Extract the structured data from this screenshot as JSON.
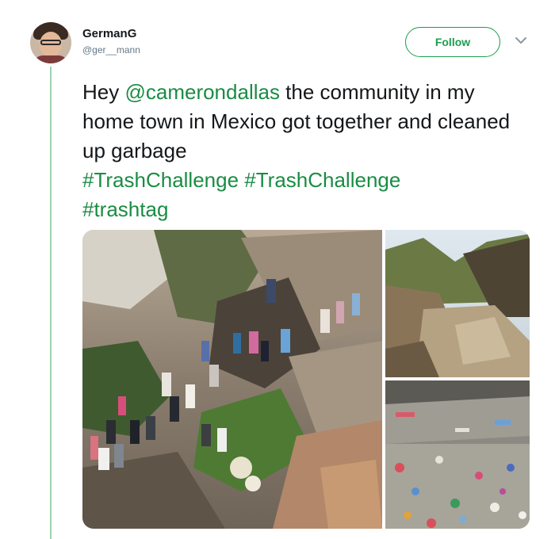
{
  "tweet": {
    "display_name": "GermanG",
    "handle": "@ger__mann",
    "follow_label": "Follow",
    "text": {
      "prefix": "Hey ",
      "mention": "@camerondallas",
      "body": " the community in my home town in Mexico got together and cleaned up garbage",
      "hashtags": [
        "#TrashChallenge",
        "#TrashChallenge",
        "#trashtag"
      ]
    }
  },
  "media": {
    "photos": [
      "hillside-cleanup-photo",
      "dry-riverbed-photo",
      "garbage-field-photo"
    ]
  },
  "colors": {
    "accent": "#1a9e4f",
    "link": "#1a8c44",
    "thread_line": "#9fd3b1"
  }
}
